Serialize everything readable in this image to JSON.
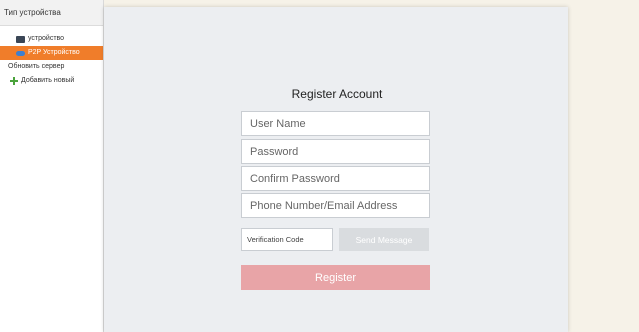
{
  "sidebar": {
    "header": "Тип устройства",
    "items": [
      {
        "label": "устройство",
        "icon": "device-icon"
      },
      {
        "label": "P2P Устройство",
        "icon": "cloud-icon",
        "active": true
      },
      {
        "label": "Обновить сервер",
        "icon": ""
      },
      {
        "label": "Добавить новый",
        "icon": "plus-icon"
      }
    ],
    "active_color": "#f07d2a"
  },
  "dialog": {
    "title": "Register Account",
    "fields": {
      "username_placeholder": "User Name",
      "password_placeholder": "Password",
      "confirm_placeholder": "Confirm Password",
      "contact_placeholder": "Phone Number/Email Address",
      "verification_placeholder": "Verification Code"
    },
    "send_message_label": "Send Message",
    "register_label": "Register",
    "register_color": "#e8a4a7"
  }
}
